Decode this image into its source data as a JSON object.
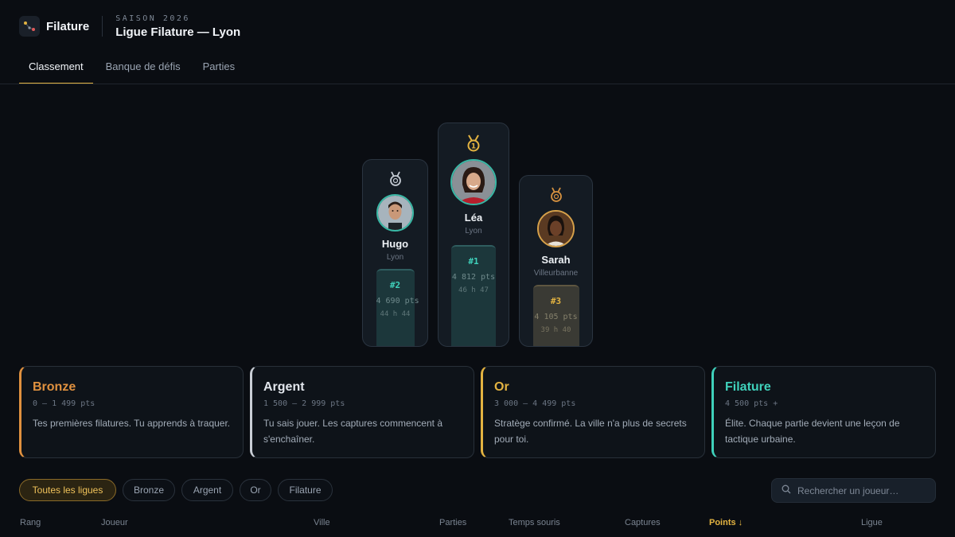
{
  "app": {
    "brand": "Filature",
    "season": "SAISON 2026",
    "league_title": "Ligue Filature — Lyon"
  },
  "tabs": [
    {
      "label": "Classement",
      "active": true
    },
    {
      "label": "Banque de défis",
      "active": false
    },
    {
      "label": "Parties",
      "active": false
    }
  ],
  "podium": {
    "first": {
      "name": "Léa",
      "city": "Lyon",
      "rank": "#1",
      "points": "4 812 pts",
      "time": "46 h 47"
    },
    "second": {
      "name": "Hugo",
      "city": "Lyon",
      "rank": "#2",
      "points": "4 690 pts",
      "time": "44 h 44"
    },
    "third": {
      "name": "Sarah",
      "city": "Villeurbanne",
      "rank": "#3",
      "points": "4 105 pts",
      "time": "39 h 40"
    }
  },
  "tiers": [
    {
      "name": "Bronze",
      "range": "0 — 1 499 pts",
      "desc": "Tes premières filatures. Tu apprends à traquer.",
      "color": "#e0913f"
    },
    {
      "name": "Argent",
      "range": "1 500 — 2 999 pts",
      "desc": "Tu sais jouer. Les captures commencent à s'enchaîner.",
      "color": "#c9ced6"
    },
    {
      "name": "Or",
      "range": "3 000 — 4 499 pts",
      "desc": "Stratège confirmé. La ville n'a plus de secrets pour toi.",
      "color": "#e3b341"
    },
    {
      "name": "Filature",
      "range": "4 500 pts +",
      "desc": "Élite. Chaque partie devient une leçon de tactique urbaine.",
      "color": "#3fd1bb"
    }
  ],
  "filters": [
    {
      "label": "Toutes les ligues",
      "active": true
    },
    {
      "label": "Bronze",
      "active": false
    },
    {
      "label": "Argent",
      "active": false
    },
    {
      "label": "Or",
      "active": false
    },
    {
      "label": "Filature",
      "active": false
    }
  ],
  "search": {
    "placeholder": "Rechercher un joueur…"
  },
  "table": {
    "columns": [
      "Rang",
      "Joueur",
      "Ville",
      "Parties",
      "Temps souris",
      "Captures",
      "Points ↓",
      "Ligue"
    ],
    "sorted_column": "Points"
  },
  "colors": {
    "accent": "#e3b341",
    "teal": "#3fd1bb",
    "background": "#0a0d12"
  }
}
